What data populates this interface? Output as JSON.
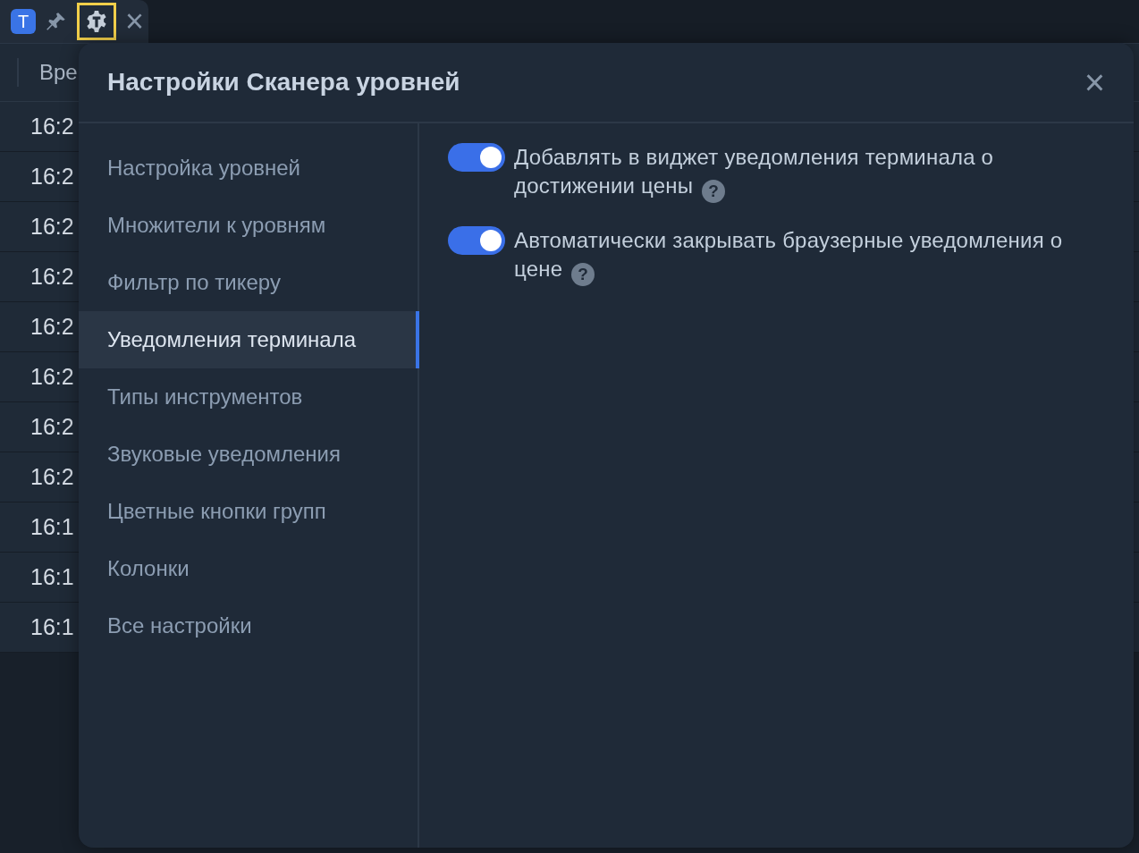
{
  "tab": {
    "badge": "T",
    "close": "×"
  },
  "table": {
    "columns": [
      "Вре"
    ],
    "rows": [
      "16:2",
      "16:2",
      "16:2",
      "16:2",
      "16:2",
      "16:2",
      "16:2",
      "16:2",
      "16:1",
      "16:1",
      "16:1"
    ]
  },
  "dialog": {
    "title": "Настройки Сканера уровней",
    "close": "×",
    "sidebar": [
      {
        "label": "Настройка уровней",
        "selected": false
      },
      {
        "label": "Множители к уровням",
        "selected": false
      },
      {
        "label": "Фильтр по тикеру",
        "selected": false
      },
      {
        "label": "Уведомления терминала",
        "selected": true
      },
      {
        "label": "Типы инструментов",
        "selected": false
      },
      {
        "label": "Звуковые уведомления",
        "selected": false
      },
      {
        "label": "Цветные кнопки групп",
        "selected": false
      },
      {
        "label": "Колонки",
        "selected": false
      },
      {
        "label": "Все настройки",
        "selected": false
      }
    ],
    "settings": [
      {
        "label": "Добавлять в виджет уведомления терминала о достижении цены",
        "on": true,
        "help": "?"
      },
      {
        "label": "Автоматически закрывать браузерные уведомления о цене",
        "on": true,
        "help": "?"
      }
    ]
  }
}
